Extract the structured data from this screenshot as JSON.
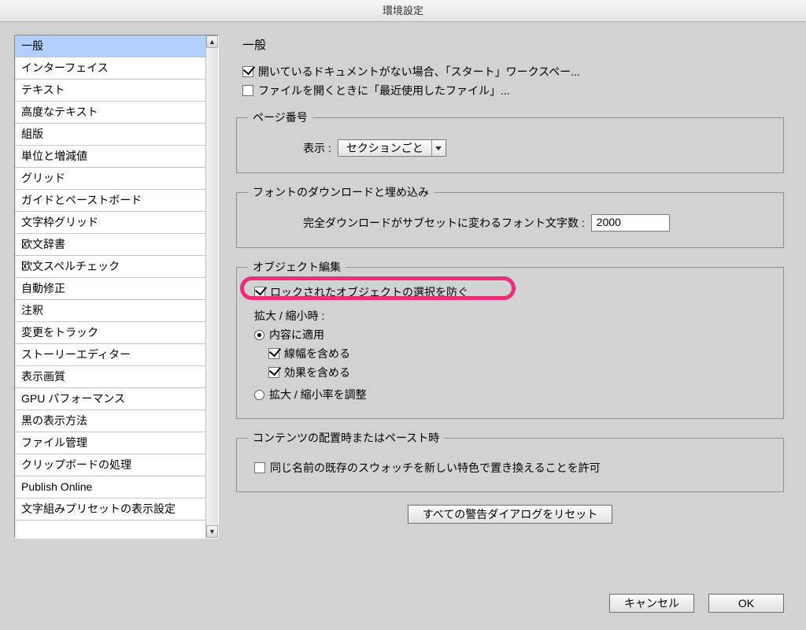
{
  "window": {
    "title": "環境設定"
  },
  "sidebar": {
    "items": [
      "一般",
      "インターフェイス",
      "テキスト",
      "高度なテキスト",
      "組版",
      "単位と増減値",
      "グリッド",
      "ガイドとペーストボード",
      "文字枠グリッド",
      "欧文辞書",
      "欧文スペルチェック",
      "自動修正",
      "注釈",
      "変更をトラック",
      "ストーリーエディター",
      "表示画質",
      "GPU パフォーマンス",
      "黒の表示方法",
      "ファイル管理",
      "クリップボードの処理",
      "Publish Online",
      "文字組みプリセットの表示設定"
    ],
    "selected_index": 0
  },
  "main": {
    "heading": "一般",
    "show_start_workspace": {
      "checked": true,
      "label": "開いているドキュメントがない場合、「スタート」ワークスペー..."
    },
    "show_recent_files": {
      "checked": false,
      "label": "ファイルを開くときに「最近使用したファイル」..."
    },
    "page_number_group": {
      "legend": "ページ番号",
      "display_label": "表示 :",
      "display_value": "セクションごと"
    },
    "font_group": {
      "legend": "フォントのダウンロードと埋め込み",
      "subset_label": "完全ダウンロードがサブセットに変わるフォント文字数 :",
      "subset_value": "2000"
    },
    "object_edit_group": {
      "legend": "オブジェクト編集",
      "prevent_locked": {
        "checked": true,
        "label": "ロックされたオブジェクトの選択を防ぐ"
      },
      "scaling_label": "拡大 / 縮小時 :",
      "apply_content": {
        "on": true,
        "label": "内容に適用"
      },
      "include_stroke": {
        "checked": true,
        "label": "線幅を含める"
      },
      "include_effect": {
        "checked": true,
        "label": "効果を含める"
      },
      "adjust_percent": {
        "on": false,
        "label": "拡大 / 縮小率を調整"
      }
    },
    "paste_group": {
      "legend": "コンテンツの配置時またはペースト時",
      "replace_swatch": {
        "checked": false,
        "label": "同じ名前の既存のスウォッチを新しい特色で置き換えることを許可"
      }
    },
    "reset_warnings_btn": "すべての警告ダイアログをリセット"
  },
  "footer": {
    "cancel": "キャンセル",
    "ok": "OK"
  }
}
